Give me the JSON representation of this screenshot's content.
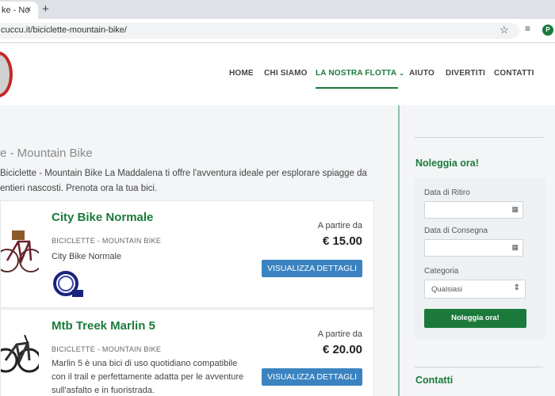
{
  "browser": {
    "tab_title": "ke - No",
    "close_glyph": "×",
    "new_tab_glyph": "+",
    "url": "cuccu.it/biciclette-mountain-bike/",
    "profile_initial": "P"
  },
  "nav": {
    "items": [
      {
        "label": "HOME"
      },
      {
        "label": "CHI SIAMO"
      },
      {
        "label": "LA NOSTRA FLOTTA",
        "active": true
      },
      {
        "label": "AIUTO"
      },
      {
        "label": "DIVERTITI"
      },
      {
        "label": "CONTATTI"
      }
    ],
    "dropdown_glyph": "⌄"
  },
  "main": {
    "title": "e - Mountain Bike",
    "intro": "Biciclette - Mountain Bike La Maddalena ti offre l'avventura ideale per esplorare spiagge da entieri nascosti. Prenota ora la tua bici.",
    "products": [
      {
        "title": "City Bike Normale",
        "category": "BICICLETTE - MOUNTAIN BIKE",
        "description": "City Bike Normale",
        "price_label": "A partire da",
        "price": "€ 15.00",
        "button": "VISUALIZZA DETTAGLI"
      },
      {
        "title": "Mtb Treek Marlin 5",
        "category": "BICICLETTE - MOUNTAIN BIKE",
        "description": "Marlin 5 è una bici di uso quotidiano compatibile con il trail e perfettamente adatta per le avventure sull'asfalto e in fuoristrada.",
        "price_label": "A partire da",
        "price": "€ 20.00",
        "button": "VISUALIZZA DETTAGLI"
      }
    ]
  },
  "sidebar": {
    "title": "Noleggia ora!",
    "pickup_label": "Data di Ritiro",
    "return_label": "Data di Consegna",
    "category_label": "Categoria",
    "category_value": "Qualsiasi",
    "submit": "Noleggia ora!",
    "contacts_title": "Contatti"
  },
  "colors": {
    "brand_green": "#1b7a3b",
    "button_blue": "#3a83c0"
  }
}
